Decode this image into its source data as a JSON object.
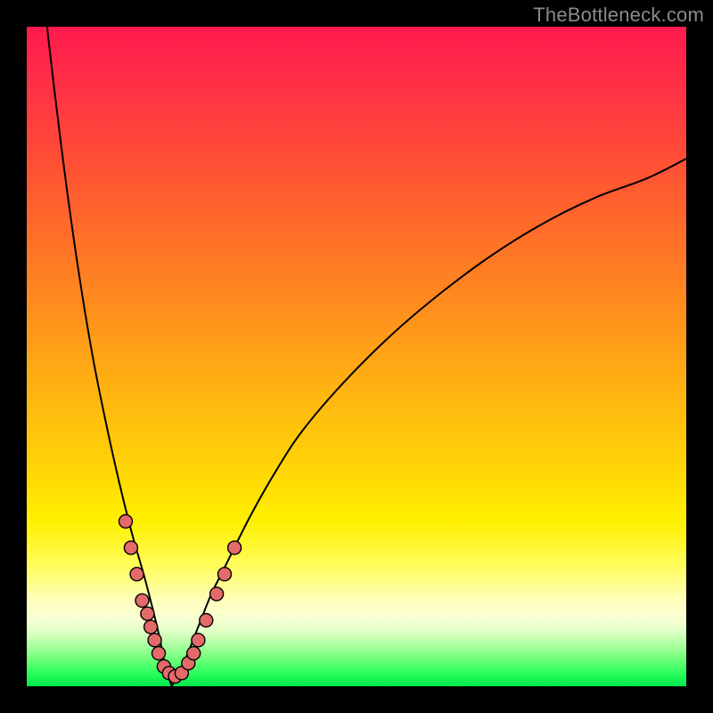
{
  "watermark": "TheBottleneck.com",
  "colors": {
    "frame": "#000000",
    "dot_fill": "#e46a6a",
    "curve": "#000000"
  },
  "chart_data": {
    "type": "line",
    "title": "",
    "xlabel": "",
    "ylabel": "",
    "xlim": [
      0,
      100
    ],
    "ylim": [
      0,
      100
    ],
    "grid": false,
    "note": "V-shaped bottleneck curve. x ≈ component balance; y ≈ bottleneck %. Minimum (green, ~0%) near x≈22. Left branch rises steeply past 100% (clipped at top-left). Right branch rises with decreasing slope toward ~80% at x=100.",
    "series": [
      {
        "name": "left_branch",
        "x": [
          0,
          2,
          4,
          6,
          8,
          10,
          12,
          14,
          16,
          18,
          20,
          21,
          22
        ],
        "y": [
          130,
          110,
          92,
          76,
          62,
          50,
          40,
          31,
          23,
          16,
          8,
          3,
          0
        ]
      },
      {
        "name": "right_branch",
        "x": [
          22,
          24,
          26,
          28,
          30,
          34,
          38,
          42,
          48,
          55,
          62,
          70,
          78,
          86,
          94,
          100
        ],
        "y": [
          0,
          4,
          9,
          14,
          18,
          26,
          33,
          39,
          46,
          53,
          59,
          65,
          70,
          74,
          77,
          80
        ]
      }
    ],
    "scatter": {
      "name": "sample_points",
      "note": "Salmon dots clustered near the trough on both branches, roughly y∈[2,25].",
      "points": [
        {
          "x": 15.0,
          "y": 25
        },
        {
          "x": 15.8,
          "y": 21
        },
        {
          "x": 16.7,
          "y": 17
        },
        {
          "x": 17.5,
          "y": 13
        },
        {
          "x": 18.3,
          "y": 11
        },
        {
          "x": 18.8,
          "y": 9
        },
        {
          "x": 19.4,
          "y": 7
        },
        {
          "x": 20.0,
          "y": 5
        },
        {
          "x": 20.8,
          "y": 3
        },
        {
          "x": 21.6,
          "y": 2
        },
        {
          "x": 22.5,
          "y": 1.5
        },
        {
          "x": 23.5,
          "y": 2
        },
        {
          "x": 24.5,
          "y": 3.5
        },
        {
          "x": 25.3,
          "y": 5
        },
        {
          "x": 26.0,
          "y": 7
        },
        {
          "x": 27.2,
          "y": 10
        },
        {
          "x": 28.8,
          "y": 14
        },
        {
          "x": 30.0,
          "y": 17
        },
        {
          "x": 31.5,
          "y": 21
        }
      ]
    }
  }
}
